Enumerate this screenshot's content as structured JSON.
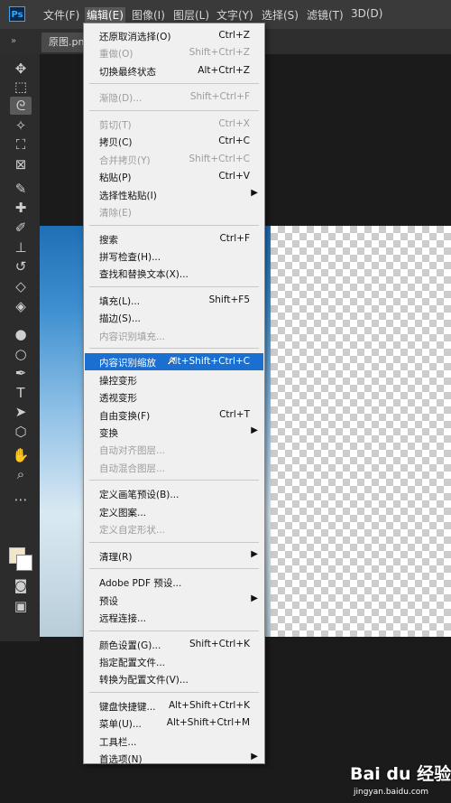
{
  "app": {
    "logo": "Ps"
  },
  "menubar": [
    {
      "label": "文件(F)",
      "active": false
    },
    {
      "label": "编辑(E)",
      "active": true
    },
    {
      "label": "图像(I)",
      "active": false
    },
    {
      "label": "图层(L)",
      "active": false
    },
    {
      "label": "文字(Y)",
      "active": false
    },
    {
      "label": "选择(S)",
      "active": false
    },
    {
      "label": "滤镜(T)",
      "active": false
    },
    {
      "label": "3D(D)",
      "active": false
    }
  ],
  "document": {
    "tab": "原图.pn"
  },
  "toolbar": {
    "collapse": "»",
    "tools": [
      {
        "name": "move-tool-icon",
        "glyph": "✥"
      },
      {
        "name": "marquee-tool-icon",
        "glyph": "⬚"
      },
      {
        "name": "lasso-tool-icon",
        "glyph": "ᘓ",
        "selected": true
      },
      {
        "name": "magic-wand-tool-icon",
        "glyph": "✧"
      },
      {
        "name": "crop-tool-icon",
        "glyph": "⛶"
      },
      {
        "name": "frame-tool-icon",
        "glyph": "⊠"
      },
      {
        "name": "eyedropper-tool-icon",
        "glyph": "✎"
      },
      {
        "name": "healing-brush-tool-icon",
        "glyph": "✚"
      },
      {
        "name": "brush-tool-icon",
        "glyph": "✐"
      },
      {
        "name": "clone-stamp-tool-icon",
        "glyph": "⊥"
      },
      {
        "name": "history-brush-tool-icon",
        "glyph": "↺"
      },
      {
        "name": "eraser-tool-icon",
        "glyph": "◇"
      },
      {
        "name": "paint-bucket-tool-icon",
        "glyph": "◈"
      },
      {
        "name": "blur-tool-icon",
        "glyph": "●"
      },
      {
        "name": "dodge-tool-icon",
        "glyph": "○"
      },
      {
        "name": "pen-tool-icon",
        "glyph": "✒"
      },
      {
        "name": "type-tool-icon",
        "glyph": "T"
      },
      {
        "name": "path-selection-tool-icon",
        "glyph": "➤"
      },
      {
        "name": "shape-tool-icon",
        "glyph": "⬡"
      },
      {
        "name": "hand-tool-icon",
        "glyph": "✋"
      },
      {
        "name": "zoom-tool-icon",
        "glyph": "⌕"
      },
      {
        "name": "more-tools-icon",
        "glyph": "⋯"
      }
    ],
    "bottom": [
      {
        "name": "quick-mask-icon",
        "glyph": "◙"
      },
      {
        "name": "screen-mode-icon",
        "glyph": "▣"
      }
    ]
  },
  "colors": {
    "foreground": "#f1e7c8",
    "background": "#ffffff",
    "highlight": "#1a6fd1"
  },
  "edit_menu": {
    "items": [
      {
        "label": "还原取消选择(O)",
        "shortcut": "Ctrl+Z",
        "disabled": false
      },
      {
        "label": "重做(O)",
        "shortcut": "Shift+Ctrl+Z",
        "disabled": true
      },
      {
        "label": "切换最终状态",
        "shortcut": "Alt+Ctrl+Z",
        "disabled": false
      },
      {
        "sep": true
      },
      {
        "label": "渐隐(D)...",
        "shortcut": "Shift+Ctrl+F",
        "disabled": true
      },
      {
        "sep": true
      },
      {
        "label": "剪切(T)",
        "shortcut": "Ctrl+X",
        "disabled": true
      },
      {
        "label": "拷贝(C)",
        "shortcut": "Ctrl+C",
        "disabled": false
      },
      {
        "label": "合并拷贝(Y)",
        "shortcut": "Shift+Ctrl+C",
        "disabled": true
      },
      {
        "label": "粘贴(P)",
        "shortcut": "Ctrl+V",
        "disabled": false
      },
      {
        "label": "选择性粘贴(I)",
        "shortcut": "",
        "disabled": false,
        "submenu": true
      },
      {
        "label": "清除(E)",
        "shortcut": "",
        "disabled": true
      },
      {
        "sep": true
      },
      {
        "label": "搜索",
        "shortcut": "Ctrl+F",
        "disabled": false
      },
      {
        "label": "拼写检查(H)...",
        "shortcut": "",
        "disabled": false
      },
      {
        "label": "查找和替换文本(X)...",
        "shortcut": "",
        "disabled": false
      },
      {
        "sep": true
      },
      {
        "label": "填充(L)...",
        "shortcut": "Shift+F5",
        "disabled": false
      },
      {
        "label": "描边(S)...",
        "shortcut": "",
        "disabled": false
      },
      {
        "label": "内容识别填充...",
        "shortcut": "",
        "disabled": true
      },
      {
        "sep": true
      },
      {
        "label": "内容识别缩放",
        "shortcut": "Alt+Shift+Ctrl+C",
        "disabled": false,
        "highlighted": true
      },
      {
        "label": "操控变形",
        "shortcut": "",
        "disabled": false
      },
      {
        "label": "透视变形",
        "shortcut": "",
        "disabled": false
      },
      {
        "label": "自由变换(F)",
        "shortcut": "Ctrl+T",
        "disabled": false
      },
      {
        "label": "变换",
        "shortcut": "",
        "disabled": false,
        "submenu": true
      },
      {
        "label": "自动对齐图层...",
        "shortcut": "",
        "disabled": true
      },
      {
        "label": "自动混合图层...",
        "shortcut": "",
        "disabled": true
      },
      {
        "sep": true
      },
      {
        "label": "定义画笔预设(B)...",
        "shortcut": "",
        "disabled": false
      },
      {
        "label": "定义图案...",
        "shortcut": "",
        "disabled": false
      },
      {
        "label": "定义自定形状...",
        "shortcut": "",
        "disabled": true
      },
      {
        "sep": true
      },
      {
        "label": "清理(R)",
        "shortcut": "",
        "disabled": false,
        "submenu": true
      },
      {
        "sep": true
      },
      {
        "label": "Adobe PDF 预设...",
        "shortcut": "",
        "disabled": false
      },
      {
        "label": "预设",
        "shortcut": "",
        "disabled": false,
        "submenu": true
      },
      {
        "label": "远程连接...",
        "shortcut": "",
        "disabled": false
      },
      {
        "sep": true
      },
      {
        "label": "颜色设置(G)...",
        "shortcut": "Shift+Ctrl+K",
        "disabled": false
      },
      {
        "label": "指定配置文件...",
        "shortcut": "",
        "disabled": false
      },
      {
        "label": "转换为配置文件(V)...",
        "shortcut": "",
        "disabled": false
      },
      {
        "sep": true
      },
      {
        "label": "键盘快捷键...",
        "shortcut": "Alt+Shift+Ctrl+K",
        "disabled": false
      },
      {
        "label": "菜单(U)...",
        "shortcut": "Alt+Shift+Ctrl+M",
        "disabled": false
      },
      {
        "label": "工具栏...",
        "shortcut": "",
        "disabled": false
      },
      {
        "label": "首选项(N)",
        "shortcut": "",
        "disabled": false,
        "submenu": true
      }
    ]
  },
  "watermark": {
    "brand": "Bai du 经验",
    "url": "jingyan.baidu.com"
  }
}
